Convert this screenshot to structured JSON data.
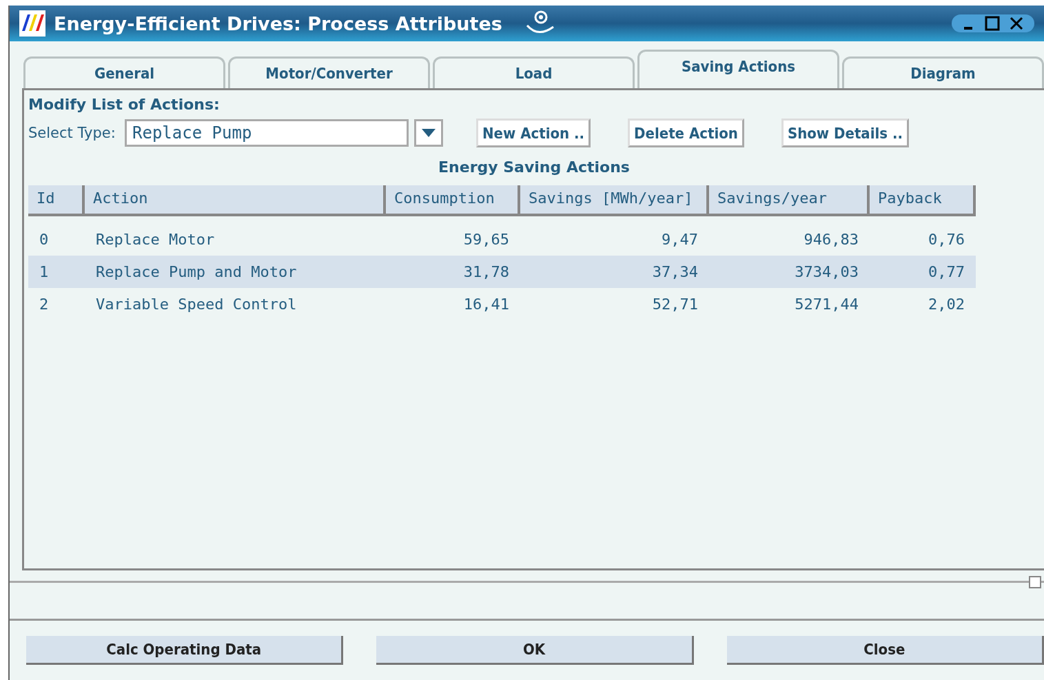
{
  "window": {
    "title": "Energy-Efficient Drives: Process Attributes"
  },
  "tabs": [
    {
      "label": "General",
      "selected": false
    },
    {
      "label": "Motor/Converter",
      "selected": false
    },
    {
      "label": "Load",
      "selected": false
    },
    {
      "label": "Saving Actions",
      "selected": true
    },
    {
      "label": "Diagram",
      "selected": false
    }
  ],
  "section_title": "Modify List of Actions:",
  "select_type": {
    "label": "Select Type:",
    "value": "Replace Pump"
  },
  "action_buttons": [
    "New Action ..",
    "Delete Action",
    "Show Details .."
  ],
  "table": {
    "title": "Energy Saving Actions",
    "columns": [
      "Id",
      "Action",
      "Consumption",
      "Savings [MWh/year]",
      "Savings/year",
      "Payback"
    ],
    "rows": [
      {
        "cells": [
          "0",
          "Replace Motor",
          "59,65",
          "9,47",
          "946,83",
          "0,76"
        ],
        "selected": false
      },
      {
        "cells": [
          "1",
          "Replace Pump and Motor",
          "31,78",
          "37,34",
          "3734,03",
          "0,77"
        ],
        "selected": true
      },
      {
        "cells": [
          "2",
          "Variable Speed Control",
          "16,41",
          "52,71",
          "5271,44",
          "2,02"
        ],
        "selected": false
      }
    ]
  },
  "footer_buttons": [
    "Calc Operating Data",
    "OK",
    "Close"
  ]
}
